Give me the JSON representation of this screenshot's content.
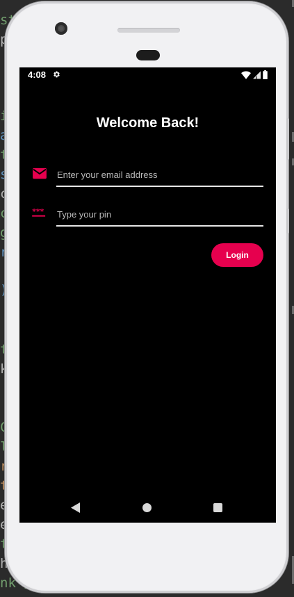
{
  "background_code_fragments": [
    {
      "text": "st",
      "color": "#7fb37a"
    },
    {
      "text": "p",
      "color": "#c9c9c9"
    },
    {
      "text": "i",
      "color": "#7fb37a"
    },
    {
      "text": "a",
      "color": "#6aa5d8"
    },
    {
      "text": "t",
      "color": "#7fb37a"
    },
    {
      "text": "s",
      "color": "#6aa5d8"
    },
    {
      "text": "c",
      "color": "#c9c9c9"
    },
    {
      "text": "c",
      "color": "#7fb37a"
    },
    {
      "text": "g",
      "color": "#7fb37a"
    },
    {
      "text": "r",
      "color": "#6aa5d8"
    },
    {
      "text": ")",
      "color": "#6aa5d8"
    },
    {
      "text": "t",
      "color": "#7fb37a"
    },
    {
      "text": "k",
      "color": "#c9c9c9"
    },
    {
      "text": "C",
      "color": "#7fb37a"
    },
    {
      "text": "l",
      "color": "#7fb37a"
    },
    {
      "text": "r",
      "color": "#d8a06a"
    },
    {
      "text": "t",
      "color": "#d8a06a"
    },
    {
      "text": "e",
      "color": "#c9c9c9"
    },
    {
      "text": "e",
      "color": "#c9c9c9"
    },
    {
      "text": "t",
      "color": "#7fb37a"
    },
    {
      "text": "h",
      "color": "#c9c9c9"
    },
    {
      "text": "nk /",
      "color": "#7fb37a"
    }
  ],
  "status_bar": {
    "time": "4:08",
    "icons": [
      "settings-gear-icon",
      "wifi-icon",
      "cell-signal-icon",
      "battery-icon"
    ]
  },
  "login_screen": {
    "title": "Welcome Back!",
    "email_field": {
      "placeholder": "Enter your email address",
      "value": "",
      "icon": "mail-icon"
    },
    "pin_field": {
      "placeholder": "Type your pin",
      "value": "",
      "icon": "password-icon"
    },
    "login_button": {
      "label": "Login"
    }
  },
  "navigation_bar": {
    "buttons": [
      "back",
      "home",
      "recents"
    ]
  },
  "colors": {
    "accent": "#e6004e",
    "screen_background": "#000000",
    "text": "#ffffff",
    "placeholder": "#b9b9b9",
    "underline": "#e6e6e6"
  }
}
